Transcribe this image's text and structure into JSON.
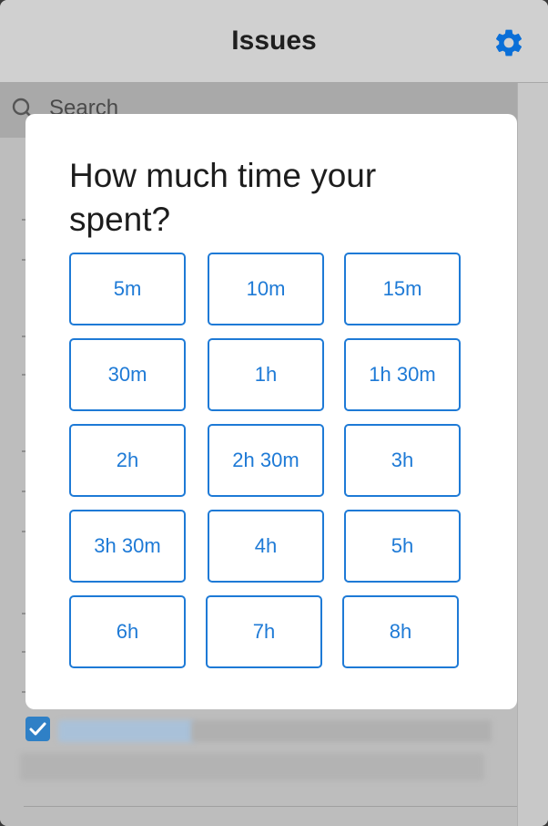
{
  "header": {
    "title": "Issues",
    "settings_icon": "gear-icon",
    "accent": "#0a6fd8"
  },
  "search": {
    "placeholder": "Search",
    "icon": "search-icon"
  },
  "modal": {
    "title": "How much time your spent?",
    "accent": "#1e7ad6",
    "options": [
      "5m",
      "10m",
      "15m",
      "30m",
      "1h",
      "1h 30m",
      "2h",
      "2h 30m",
      "3h",
      "3h 30m",
      "4h",
      "5h",
      "6h",
      "7h",
      "8h"
    ]
  },
  "list": {
    "checkbox_checked": true
  }
}
